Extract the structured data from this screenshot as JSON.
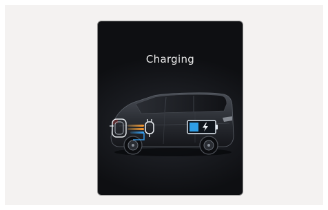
{
  "screen": {
    "title": "Charging"
  },
  "vehicle": {
    "battery_icon": "battery-charging-icon",
    "plug_icon": "charging-plug-icon",
    "charger_icon": "charging-station-icon",
    "accent_color": "#2f9ee6"
  }
}
